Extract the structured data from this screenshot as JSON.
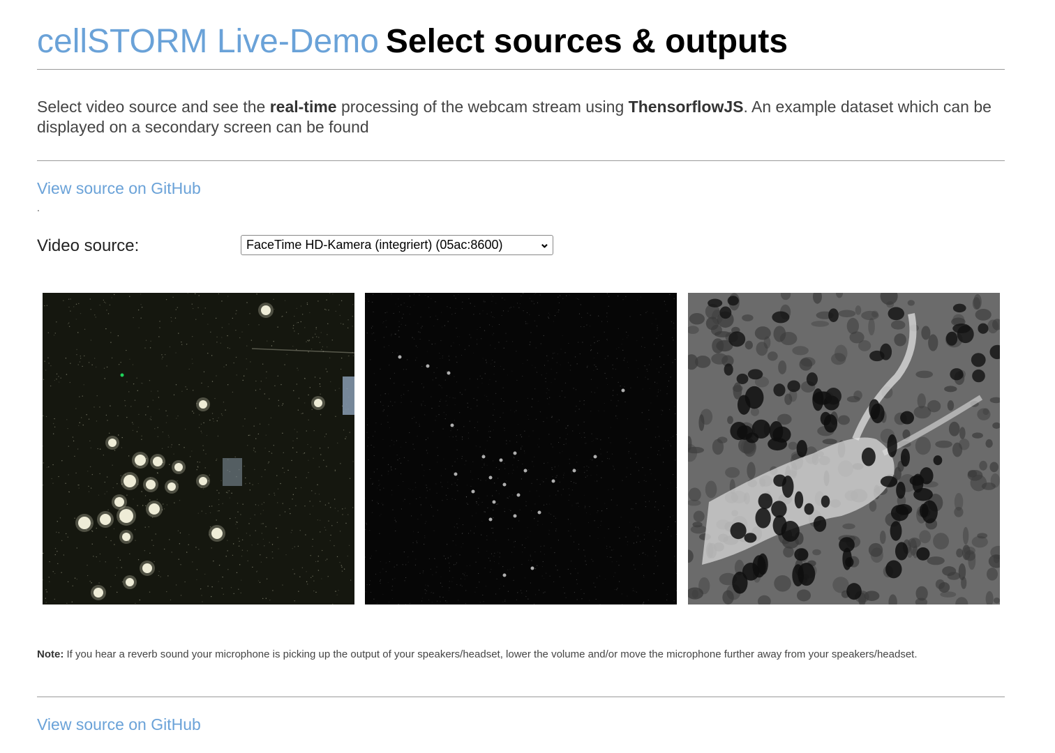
{
  "header": {
    "title_link": "cellSTORM Live-Demo",
    "subtitle": "Select sources & outputs"
  },
  "intro": {
    "part1": "Select video source and see the ",
    "bold1": "real-time",
    "part2": " processing of the webcam stream using ",
    "bold2": "ThensorflowJS",
    "part3": ". An example dataset which can be displayed on a secondary screen can be found"
  },
  "github_link_top": "View source on GitHub",
  "period": ".",
  "video_source": {
    "label": "Video source:",
    "selected": "FaceTime HD-Kamera (integriert) (05ac:8600)"
  },
  "panels": [
    {
      "name": "raw-webcam-frame"
    },
    {
      "name": "processed-frame"
    },
    {
      "name": "reconstruction-frame"
    }
  ],
  "note": {
    "label": "Note:",
    "text": " If you hear a reverb sound your microphone is picking up the output of your speakers/headset, lower the volume and/or move the microphone further away from your speakers/headset."
  },
  "github_link_bottom": "View source on GitHub",
  "colors": {
    "link": "#6aa2d8",
    "rule": "#999999"
  }
}
